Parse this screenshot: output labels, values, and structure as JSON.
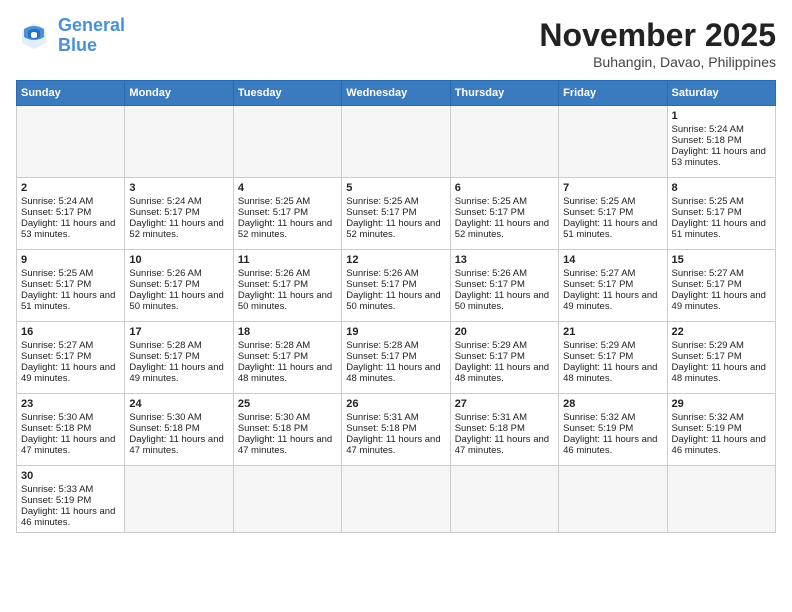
{
  "header": {
    "logo_general": "General",
    "logo_blue": "Blue",
    "month_title": "November 2025",
    "location": "Buhangin, Davao, Philippines"
  },
  "days_of_week": [
    "Sunday",
    "Monday",
    "Tuesday",
    "Wednesday",
    "Thursday",
    "Friday",
    "Saturday"
  ],
  "weeks": [
    [
      {
        "day": "",
        "empty": true
      },
      {
        "day": "",
        "empty": true
      },
      {
        "day": "",
        "empty": true
      },
      {
        "day": "",
        "empty": true
      },
      {
        "day": "",
        "empty": true
      },
      {
        "day": "",
        "empty": true
      },
      {
        "day": "1",
        "sunrise": "5:24 AM",
        "sunset": "5:18 PM",
        "daylight": "11 hours and 53 minutes."
      }
    ],
    [
      {
        "day": "2",
        "sunrise": "5:24 AM",
        "sunset": "5:17 PM",
        "daylight": "11 hours and 53 minutes."
      },
      {
        "day": "3",
        "sunrise": "5:24 AM",
        "sunset": "5:17 PM",
        "daylight": "11 hours and 52 minutes."
      },
      {
        "day": "4",
        "sunrise": "5:25 AM",
        "sunset": "5:17 PM",
        "daylight": "11 hours and 52 minutes."
      },
      {
        "day": "5",
        "sunrise": "5:25 AM",
        "sunset": "5:17 PM",
        "daylight": "11 hours and 52 minutes."
      },
      {
        "day": "6",
        "sunrise": "5:25 AM",
        "sunset": "5:17 PM",
        "daylight": "11 hours and 52 minutes."
      },
      {
        "day": "7",
        "sunrise": "5:25 AM",
        "sunset": "5:17 PM",
        "daylight": "11 hours and 51 minutes."
      },
      {
        "day": "8",
        "sunrise": "5:25 AM",
        "sunset": "5:17 PM",
        "daylight": "11 hours and 51 minutes."
      }
    ],
    [
      {
        "day": "9",
        "sunrise": "5:25 AM",
        "sunset": "5:17 PM",
        "daylight": "11 hours and 51 minutes."
      },
      {
        "day": "10",
        "sunrise": "5:26 AM",
        "sunset": "5:17 PM",
        "daylight": "11 hours and 50 minutes."
      },
      {
        "day": "11",
        "sunrise": "5:26 AM",
        "sunset": "5:17 PM",
        "daylight": "11 hours and 50 minutes."
      },
      {
        "day": "12",
        "sunrise": "5:26 AM",
        "sunset": "5:17 PM",
        "daylight": "11 hours and 50 minutes."
      },
      {
        "day": "13",
        "sunrise": "5:26 AM",
        "sunset": "5:17 PM",
        "daylight": "11 hours and 50 minutes."
      },
      {
        "day": "14",
        "sunrise": "5:27 AM",
        "sunset": "5:17 PM",
        "daylight": "11 hours and 49 minutes."
      },
      {
        "day": "15",
        "sunrise": "5:27 AM",
        "sunset": "5:17 PM",
        "daylight": "11 hours and 49 minutes."
      }
    ],
    [
      {
        "day": "16",
        "sunrise": "5:27 AM",
        "sunset": "5:17 PM",
        "daylight": "11 hours and 49 minutes."
      },
      {
        "day": "17",
        "sunrise": "5:28 AM",
        "sunset": "5:17 PM",
        "daylight": "11 hours and 49 minutes."
      },
      {
        "day": "18",
        "sunrise": "5:28 AM",
        "sunset": "5:17 PM",
        "daylight": "11 hours and 48 minutes."
      },
      {
        "day": "19",
        "sunrise": "5:28 AM",
        "sunset": "5:17 PM",
        "daylight": "11 hours and 48 minutes."
      },
      {
        "day": "20",
        "sunrise": "5:29 AM",
        "sunset": "5:17 PM",
        "daylight": "11 hours and 48 minutes."
      },
      {
        "day": "21",
        "sunrise": "5:29 AM",
        "sunset": "5:17 PM",
        "daylight": "11 hours and 48 minutes."
      },
      {
        "day": "22",
        "sunrise": "5:29 AM",
        "sunset": "5:17 PM",
        "daylight": "11 hours and 48 minutes."
      }
    ],
    [
      {
        "day": "23",
        "sunrise": "5:30 AM",
        "sunset": "5:18 PM",
        "daylight": "11 hours and 47 minutes."
      },
      {
        "day": "24",
        "sunrise": "5:30 AM",
        "sunset": "5:18 PM",
        "daylight": "11 hours and 47 minutes."
      },
      {
        "day": "25",
        "sunrise": "5:30 AM",
        "sunset": "5:18 PM",
        "daylight": "11 hours and 47 minutes."
      },
      {
        "day": "26",
        "sunrise": "5:31 AM",
        "sunset": "5:18 PM",
        "daylight": "11 hours and 47 minutes."
      },
      {
        "day": "27",
        "sunrise": "5:31 AM",
        "sunset": "5:18 PM",
        "daylight": "11 hours and 47 minutes."
      },
      {
        "day": "28",
        "sunrise": "5:32 AM",
        "sunset": "5:19 PM",
        "daylight": "11 hours and 46 minutes."
      },
      {
        "day": "29",
        "sunrise": "5:32 AM",
        "sunset": "5:19 PM",
        "daylight": "11 hours and 46 minutes."
      }
    ],
    [
      {
        "day": "30",
        "sunrise": "5:33 AM",
        "sunset": "5:19 PM",
        "daylight": "11 hours and 46 minutes."
      },
      {
        "day": "",
        "empty": true
      },
      {
        "day": "",
        "empty": true
      },
      {
        "day": "",
        "empty": true
      },
      {
        "day": "",
        "empty": true
      },
      {
        "day": "",
        "empty": true
      },
      {
        "day": "",
        "empty": true
      }
    ]
  ]
}
